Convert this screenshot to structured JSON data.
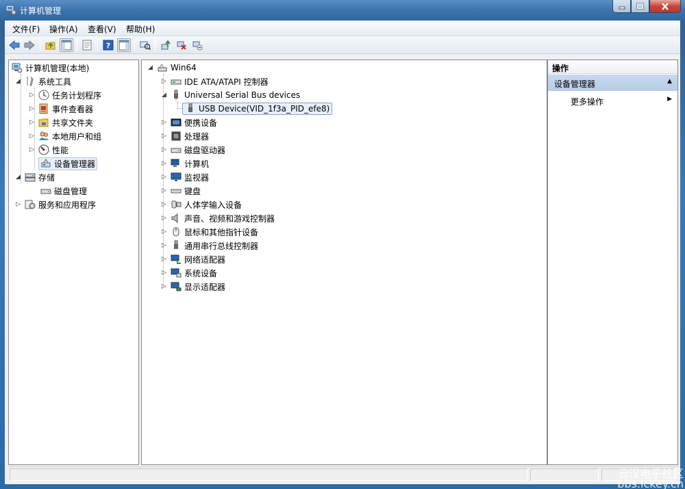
{
  "window": {
    "title": "计算机管理"
  },
  "menubar": {
    "items": [
      "文件(F)",
      "操作(A)",
      "查看(V)",
      "帮助(H)"
    ]
  },
  "left_tree": {
    "root": "计算机管理(本地)",
    "system_tools": "系统工具",
    "system_tools_children": [
      "任务计划程序",
      "事件查看器",
      "共享文件夹",
      "本地用户和组",
      "性能",
      "设备管理器"
    ],
    "storage": "存储",
    "storage_children": [
      "磁盘管理"
    ],
    "services": "服务和应用程序"
  },
  "device_tree": {
    "root": "Win64",
    "categories": [
      "IDE ATA/ATAPI 控制器",
      "Universal Serial Bus devices",
      "便携设备",
      "处理器",
      "磁盘驱动器",
      "计算机",
      "监视器",
      "键盘",
      "人体学输入设备",
      "声音、视频和游戏控制器",
      "鼠标和其他指针设备",
      "通用串行总线控制器",
      "网络适配器",
      "系统设备",
      "显示适配器"
    ],
    "usb_child": "USB Device(VID_1f3a_PID_efe8)"
  },
  "actions": {
    "header": "操作",
    "section": "设备管理器",
    "more": "更多操作"
  },
  "watermark": {
    "line1": "云汉电子社区",
    "line2": "bbs.ickey.cn"
  },
  "colors": {
    "titlebar": "#3c74ad",
    "selection": "#e5f0fb",
    "actions_section": "#c8d9ee"
  }
}
